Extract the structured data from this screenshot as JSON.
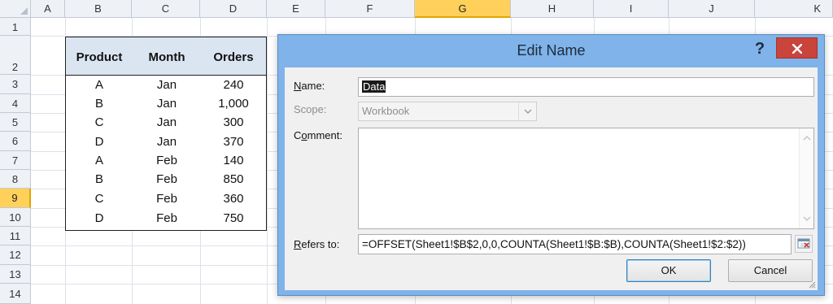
{
  "sheet": {
    "columns": [
      "A",
      "B",
      "C",
      "D",
      "E",
      "F",
      "G",
      "H",
      "I",
      "J",
      "K"
    ],
    "active_column": "G",
    "rows": [
      "1",
      "2",
      "3",
      "4",
      "5",
      "6",
      "7",
      "8",
      "9",
      "10",
      "11",
      "12",
      "13",
      "14"
    ],
    "active_row": "9"
  },
  "table": {
    "headers": [
      "Product",
      "Month",
      "Orders"
    ],
    "rows": [
      [
        "A",
        "Jan",
        "240"
      ],
      [
        "B",
        "Jan",
        "1,000"
      ],
      [
        "C",
        "Jan",
        "300"
      ],
      [
        "D",
        "Jan",
        "370"
      ],
      [
        "A",
        "Feb",
        "140"
      ],
      [
        "B",
        "Feb",
        "850"
      ],
      [
        "C",
        "Feb",
        "360"
      ],
      [
        "D",
        "Feb",
        "750"
      ]
    ]
  },
  "dialog": {
    "title": "Edit Name",
    "help_label": "?",
    "name_label_key": "N",
    "name_label_rest": "ame:",
    "name_value": "Data",
    "scope_label": "Scope:",
    "scope_value": "Workbook",
    "comment_label_pre": "C",
    "comment_label_key": "o",
    "comment_label_rest": "mment:",
    "comment_value": "",
    "refers_label_key": "R",
    "refers_label_rest": "efers to:",
    "refers_value": "=OFFSET(Sheet1!$B$2,0,0,COUNTA(Sheet1!$B:$B),COUNTA(Sheet1!$2:$2))",
    "ok_label": "OK",
    "cancel_label": "Cancel"
  },
  "icons": {
    "close": "close-icon",
    "dropdown": "chevron-down-icon",
    "collapse": "collapse-dialog-icon",
    "resize": "resize-grip-icon"
  },
  "colors": {
    "dialog_frame": "#7fb3e9",
    "close_button": "#c9443b",
    "header_fill": "#dbe5f1",
    "active_header": "#ffd15b"
  }
}
